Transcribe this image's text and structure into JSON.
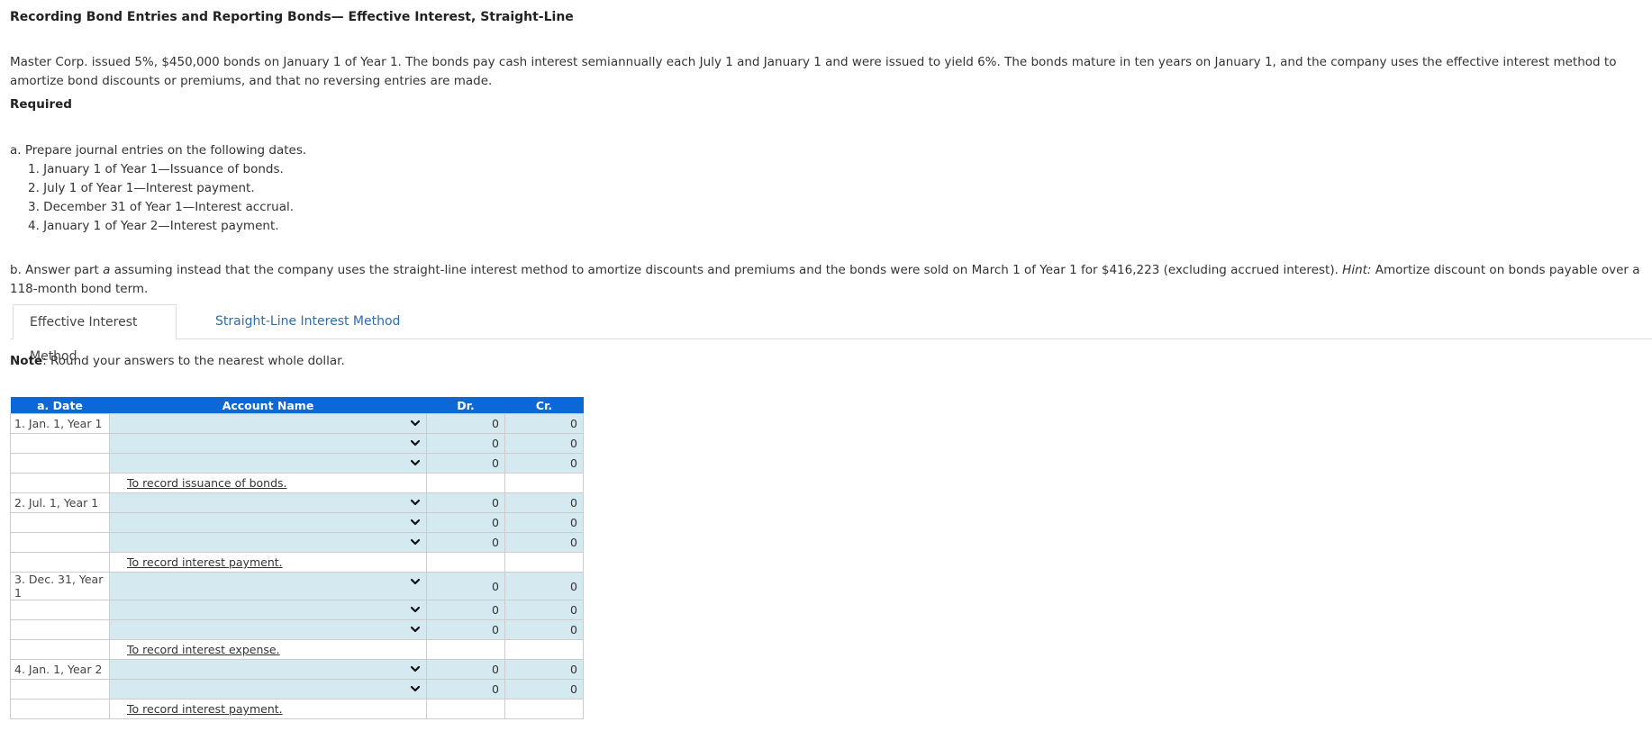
{
  "title": "Recording Bond Entries and Reporting Bonds— Effective Interest, Straight-Line",
  "intro": "Master Corp. issued 5%, $450,000 bonds on January 1 of Year 1. The bonds pay cash interest semiannually each July 1 and January 1 and were issued to yield 6%. The bonds mature in ten years on January 1, and the company uses the effective interest method to amortize bond discounts or premiums, and that no reversing entries are made.",
  "required_label": "Required",
  "part_a": {
    "lead": "a. Prepare journal entries on the following dates.",
    "items": [
      "1. January 1 of Year 1—Issuance of bonds.",
      "2. July 1 of Year 1—Interest payment.",
      "3. December 31 of Year 1—Interest accrual.",
      "4. January 1 of Year 2—Interest payment."
    ]
  },
  "part_b": {
    "text_before": "b. Answer part ",
    "italic_a": "a",
    "text_middle": " assuming instead that the company uses the straight-line interest method to amortize discounts and premiums and the bonds were sold on March 1 of Year 1 for $416,223 (excluding accrued interest). ",
    "hint_label": "Hint:",
    "text_after": " Amortize discount on bonds payable over a 118-month bond term."
  },
  "tabs": [
    {
      "label": "Effective Interest Method",
      "active": true
    },
    {
      "label": "Straight-Line Interest Method",
      "active": false
    }
  ],
  "note": {
    "label": "Note",
    "text": ": Round your answers to the nearest whole dollar."
  },
  "table": {
    "headers": {
      "date": "a. Date",
      "account": "Account Name",
      "dr": "Dr.",
      "cr": "Cr."
    },
    "entries": [
      {
        "date": "1. Jan. 1, Year 1",
        "lines": [
          {
            "account": "",
            "dr": "0",
            "cr": "0"
          },
          {
            "account": "",
            "dr": "0",
            "cr": "0"
          },
          {
            "account": "",
            "dr": "0",
            "cr": "0"
          }
        ],
        "memo": "To record issuance of bonds."
      },
      {
        "date": "2. Jul. 1, Year 1",
        "lines": [
          {
            "account": "",
            "dr": "0",
            "cr": "0"
          },
          {
            "account": "",
            "dr": "0",
            "cr": "0"
          },
          {
            "account": "",
            "dr": "0",
            "cr": "0"
          }
        ],
        "memo": "To record interest payment."
      },
      {
        "date": "3. Dec. 31, Year 1",
        "lines": [
          {
            "account": "",
            "dr": "0",
            "cr": "0"
          },
          {
            "account": "",
            "dr": "0",
            "cr": "0"
          },
          {
            "account": "",
            "dr": "0",
            "cr": "0"
          }
        ],
        "memo": "To record interest expense."
      },
      {
        "date": "4. Jan. 1, Year 2",
        "lines": [
          {
            "account": "",
            "dr": "0",
            "cr": "0"
          },
          {
            "account": "",
            "dr": "0",
            "cr": "0"
          }
        ],
        "memo": "To record interest payment."
      }
    ]
  },
  "colors": {
    "header_bg": "#0b68d6",
    "input_bg": "#d5eaf0",
    "link": "#2a6db0"
  }
}
